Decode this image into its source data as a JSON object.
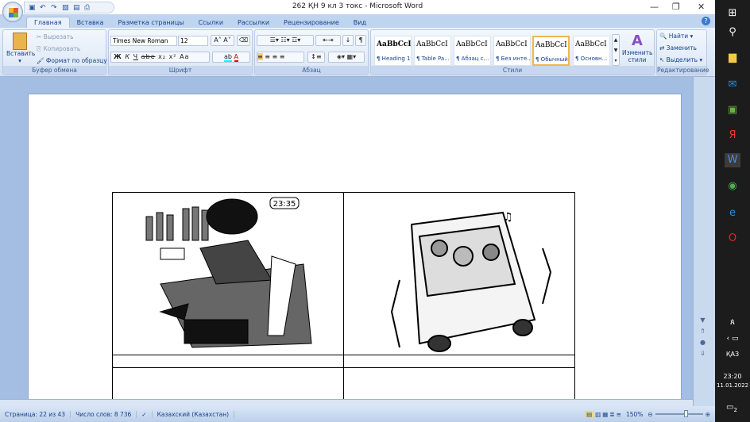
{
  "window": {
    "title": "262 ҚН 9 кл 3 токс  -  Microsoft Word"
  },
  "tabs": [
    "Главная",
    "Вставка",
    "Разметка страницы",
    "Ссылки",
    "Рассылки",
    "Рецензирование",
    "Вид"
  ],
  "clipboard": {
    "paste": "Вставить",
    "cut": "Вырезать",
    "copy": "Копировать",
    "format_painter": "Формат по образцу",
    "label": "Буфер обмена"
  },
  "font": {
    "name": "Times New Roman",
    "size": "12",
    "bold": "Ж",
    "italic": "К",
    "underline": "Ч",
    "strike": "abe",
    "sub": "x₂",
    "sup": "x²",
    "case": "Aa",
    "color_a": "A",
    "label": "Шрифт"
  },
  "paragraph": {
    "label": "Абзац",
    "pilcrow": "¶"
  },
  "styles": {
    "label": "Стили",
    "items": [
      {
        "preview": "AaBbCcI",
        "name": "¶ Heading 1"
      },
      {
        "preview": "AaBbCcI",
        "name": "¶ Table Pa..."
      },
      {
        "preview": "AaBbCcI",
        "name": "¶ Абзац с..."
      },
      {
        "preview": "AaBbCcI",
        "name": "¶ Без инте..."
      },
      {
        "preview": "AaBbCcI",
        "name": "¶ Обычный"
      },
      {
        "preview": "AaBbCcI",
        "name": "¶ Основн..."
      }
    ],
    "change": "Изменить стили"
  },
  "editing": {
    "label": "Редактирование",
    "find": "Найти",
    "replace": "Заменить",
    "select": "Выделить"
  },
  "document": {
    "clock": "23:35"
  },
  "status": {
    "page": "Страница: 22 из 43",
    "words": "Число слов: 8 736",
    "language": "Казахский (Казахстан)",
    "zoom": "150%",
    "zoom_percent": 150
  },
  "taskbar": {
    "lang": "ҚАЗ",
    "time": "23:20",
    "date": "11.01.2022",
    "notifications": "2"
  }
}
